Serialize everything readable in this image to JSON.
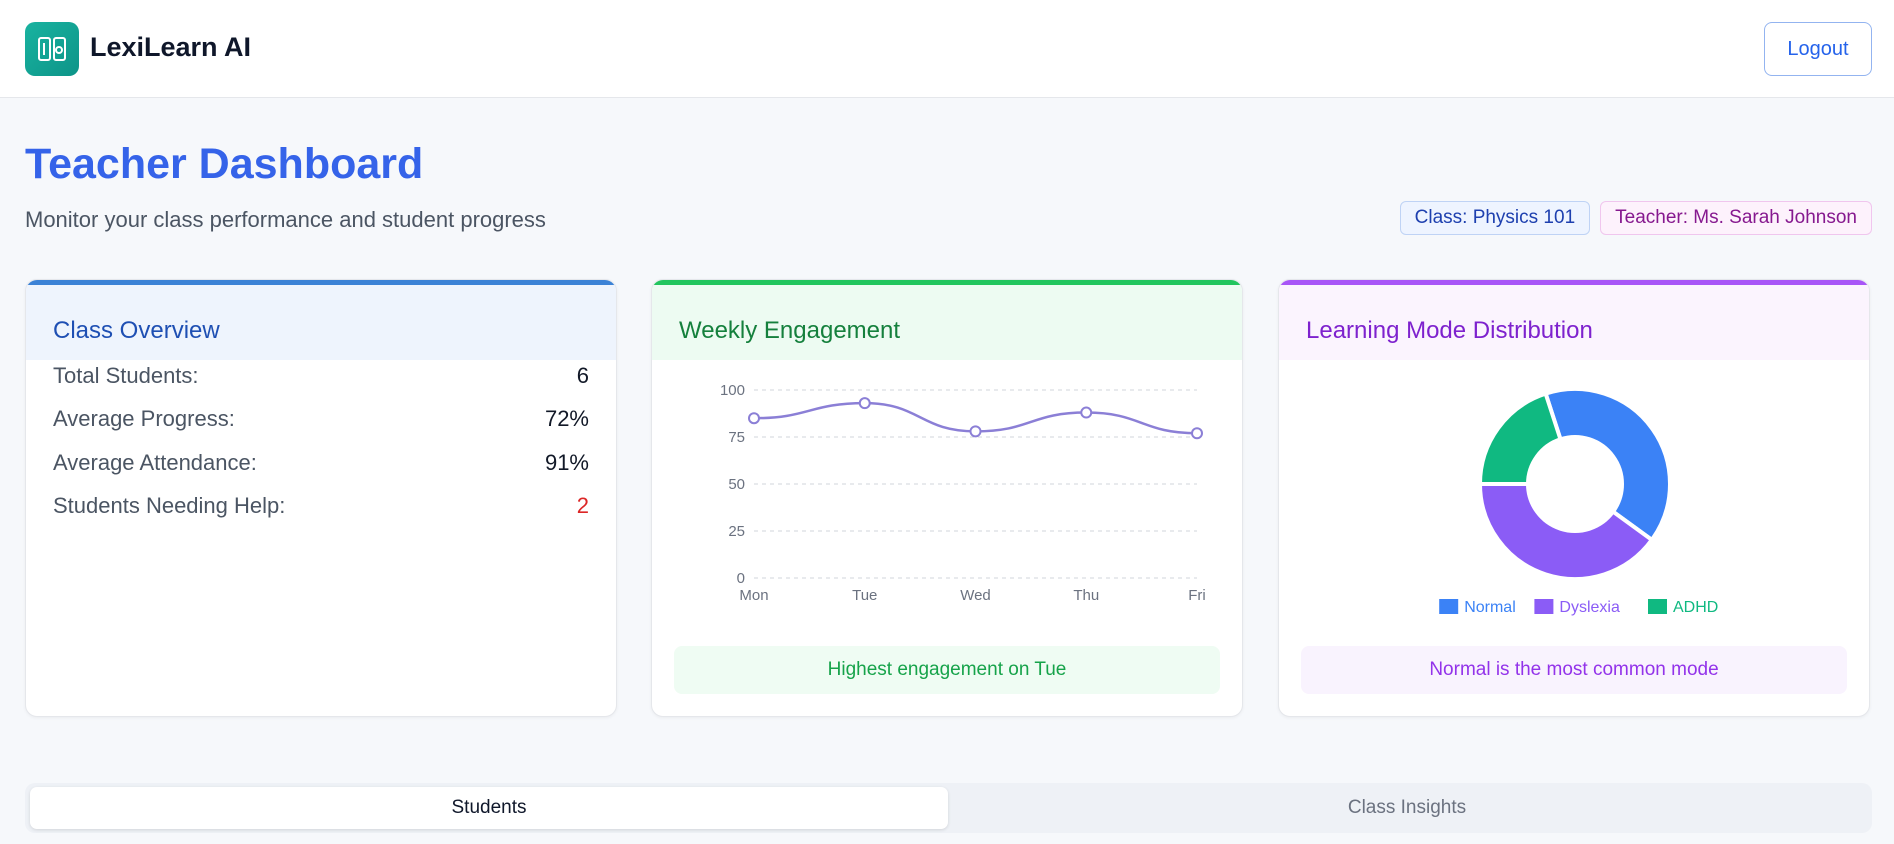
{
  "app": {
    "brand": "LexiLearn AI",
    "logo_icon": "book-reader-icon",
    "logout_label": "Logout"
  },
  "header": {
    "title": "Teacher Dashboard",
    "subtitle": "Monitor your class performance and student progress",
    "class_badge": "Class: Physics 101",
    "teacher_badge": "Teacher: Ms. Sarah Johnson"
  },
  "overview": {
    "title": "Class Overview",
    "rows": [
      {
        "label": "Total Students:",
        "value": "6"
      },
      {
        "label": "Average Progress:",
        "value": "72%"
      },
      {
        "label": "Average Attendance:",
        "value": "91%"
      },
      {
        "label": "Students Needing Help:",
        "value": "2"
      }
    ]
  },
  "engagement": {
    "title": "Weekly Engagement",
    "note": "Highest engagement on Tue",
    "chart_data": {
      "type": "line",
      "categories": [
        "Mon",
        "Tue",
        "Wed",
        "Thu",
        "Fri"
      ],
      "series": [
        {
          "values": [
            85,
            93,
            78,
            88,
            77
          ]
        }
      ],
      "ylim": [
        0,
        100
      ],
      "yticks": [
        0,
        25,
        50,
        75,
        100
      ],
      "grid": true,
      "color": "#8b7fd6"
    }
  },
  "distribution": {
    "title": "Learning Mode Distribution",
    "note": "Normal is the most common mode",
    "chart_data": {
      "type": "pie",
      "donut": true,
      "categories": [
        "Normal",
        "Dyslexia",
        "ADHD"
      ],
      "values": [
        2,
        2,
        1
      ],
      "colors": [
        "#3b82f6",
        "#8b5cf6",
        "#10b981"
      ],
      "legend": "bottom"
    }
  },
  "tabs": [
    "Students",
    "Class Insights"
  ],
  "colors": {
    "primary": "#3563e9",
    "danger": "#dc2626",
    "brand": "#0d9488"
  }
}
